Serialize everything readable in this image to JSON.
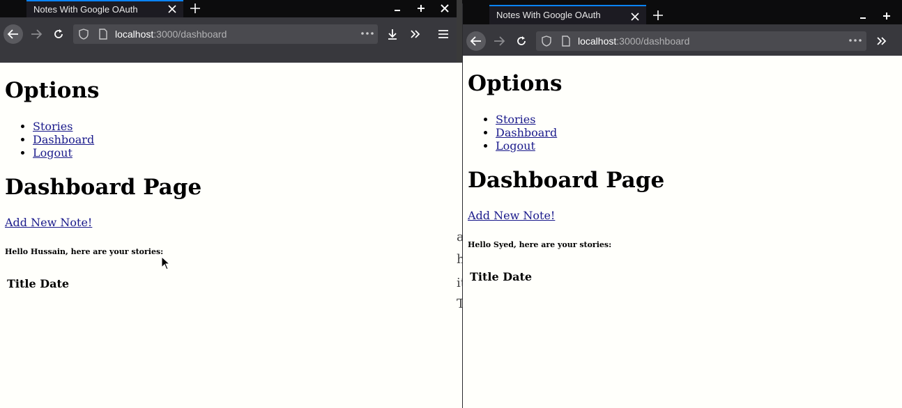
{
  "left_window": {
    "tab_title": "Notes With Google OAuth",
    "url_host": "localhost",
    "url_rest": ":3000/dashboard",
    "page": {
      "options_heading": "Options",
      "nav": [
        "Stories",
        "Dashboard",
        "Logout"
      ],
      "dashboard_heading": "Dashboard Page",
      "add_link": "Add New Note!",
      "greeting": "Hello Hussain, here are your stories:",
      "table_headers": [
        "Title",
        "Date"
      ]
    }
  },
  "right_window": {
    "tab_title": "Notes With Google OAuth",
    "url_host": "localhost",
    "url_rest": ":3000/dashboard",
    "page": {
      "options_heading": "Options",
      "nav": [
        "Stories",
        "Dashboard",
        "Logout"
      ],
      "dashboard_heading": "Dashboard Page",
      "add_link": "Add New Note!",
      "greeting": "Hello Syed, here are your stories:",
      "table_headers": [
        "Title",
        "Date"
      ]
    }
  },
  "background_strip_chars": [
    "a",
    "h",
    "it",
    "T"
  ],
  "icons": [
    "close-icon",
    "plus-icon",
    "minimize-icon",
    "back-arrow-icon",
    "forward-arrow-icon",
    "reload-icon",
    "shield-icon",
    "page-icon",
    "more-dots-icon",
    "download-icon",
    "overflow-chevrons-icon",
    "menu-icon",
    "mouse-cursor-icon"
  ],
  "colors": {
    "accent": "#0a84ff",
    "toolbar": "#38383d",
    "urlbar": "#4a4a4f",
    "link": "#1a1a8b",
    "page_bg": "#fffffb"
  }
}
